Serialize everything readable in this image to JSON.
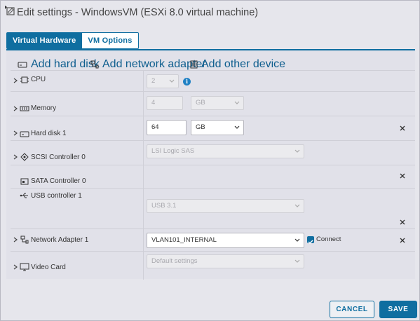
{
  "dialog": {
    "title": "Edit settings - WindowsVM (ESXi 8.0 virtual machine)"
  },
  "tabs": [
    {
      "label": "Virtual Hardware",
      "active": true
    },
    {
      "label": "VM Options",
      "active": false
    }
  ],
  "toolbar": {
    "add_hard_disk": "Add hard disk",
    "add_network_adapter": "Add network adapter",
    "add_other_device": "Add other device"
  },
  "hardware": {
    "cpu": {
      "label": "CPU",
      "value": "2"
    },
    "memory": {
      "label": "Memory",
      "value": "4",
      "unit": "GB"
    },
    "hard_disk": {
      "label": "Hard disk 1",
      "value": "64",
      "unit": "GB"
    },
    "scsi": {
      "label": "SCSI Controller 0",
      "value": "LSI Logic SAS"
    },
    "sata": {
      "label": "SATA Controller 0"
    },
    "usb": {
      "label": "USB controller 1",
      "value": "USB 3.1"
    },
    "network": {
      "label": "Network Adapter 1",
      "value": "VLAN101_INTERNAL",
      "connect_label": "Connect",
      "connected": true
    },
    "video": {
      "label": "Video Card",
      "value": "Default settings"
    }
  },
  "footer": {
    "cancel_label": "CANCEL",
    "save_label": "SAVE"
  },
  "colors": {
    "accent": "#0f6ea0",
    "info": "#1f80c4"
  }
}
